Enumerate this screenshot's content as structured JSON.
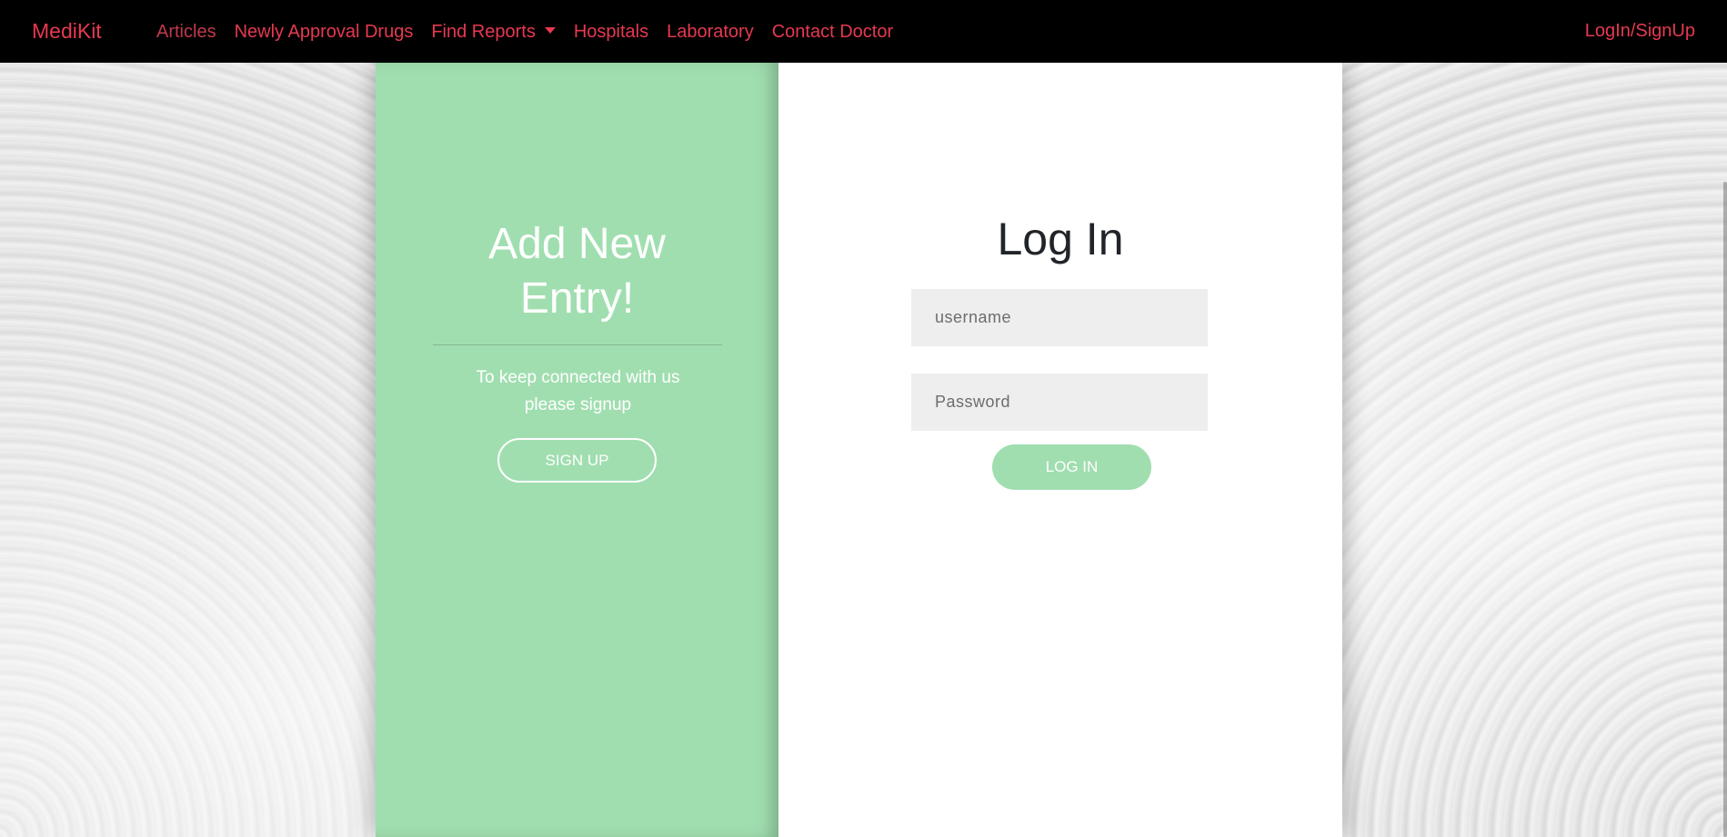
{
  "colors": {
    "accent": "#e63950",
    "accent_dim": "#c0394c",
    "navbar_bg": "#000000",
    "panel_green": "#a0deaf",
    "panel_white": "#ffffff",
    "field_bg": "#eeeeee"
  },
  "navbar": {
    "brand": "MediKit",
    "links": [
      {
        "label": "Articles",
        "active": true
      },
      {
        "label": "Newly Approval Drugs",
        "active": false
      },
      {
        "label": "Find Reports",
        "active": false,
        "dropdown": true
      },
      {
        "label": "Hospitals",
        "active": false
      },
      {
        "label": "Laboratory",
        "active": false
      },
      {
        "label": "Contact Doctor",
        "active": false
      }
    ],
    "auth_link": "LogIn/SignUp",
    "dropdown_icon": "caret-down-icon"
  },
  "signup_panel": {
    "title": "Add New Entry!",
    "text": "To keep connected with us please signup",
    "button_label": "SIGN UP"
  },
  "login_panel": {
    "title": "Log In",
    "username_placeholder": "username",
    "username_value": "",
    "password_placeholder": "Password",
    "password_value": "",
    "button_label": "LOG IN"
  }
}
